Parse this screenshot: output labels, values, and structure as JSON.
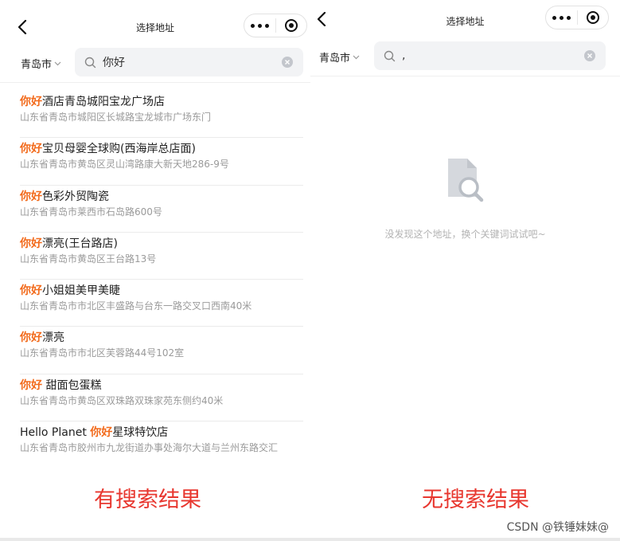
{
  "left": {
    "nav_title": "选择地址",
    "city": "青岛市",
    "search_value": "你好",
    "results": [
      {
        "highlight": "你好",
        "prefix": "",
        "name": "酒店青岛城阳宝龙广场店",
        "address": "山东省青岛市城阳区长城路宝龙城市广场东门"
      },
      {
        "highlight": "你好",
        "prefix": "",
        "name": "宝贝母婴全球购(西海岸总店面)",
        "address": "山东省青岛市黄岛区灵山湾路康大新天地286-9号"
      },
      {
        "highlight": "你好",
        "prefix": "",
        "name": "色彩外贸陶瓷",
        "address": "山东省青岛市莱西市石岛路600号"
      },
      {
        "highlight": "你好",
        "prefix": "",
        "name": "漂亮(王台路店)",
        "address": "山东省青岛市黄岛区王台路13号"
      },
      {
        "highlight": "你好",
        "prefix": "",
        "name": "小姐姐美甲美睫",
        "address": "山东省青岛市市北区丰盛路与台东一路交叉口西南40米"
      },
      {
        "highlight": "你好",
        "prefix": "",
        "name": "漂亮",
        "address": "山东省青岛市市北区芙蓉路44号102室"
      },
      {
        "highlight": "你好",
        "prefix": "",
        "name": " 甜面包蛋糕",
        "address": "山东省青岛市黄岛区双珠路双珠家苑东侧约40米"
      },
      {
        "highlight": "你好",
        "prefix": "Hello Planet ",
        "name": "星球特饮店",
        "address": "山东省青岛市胶州市九龙街道办事处海尔大道与兰州东路交汇"
      }
    ],
    "caption": "有搜索结果"
  },
  "right": {
    "nav_title": "选择地址",
    "city": "青岛市",
    "search_value": ",",
    "empty_message": "没发现这个地址，换个关键词试试吧~",
    "caption": "无搜索结果"
  },
  "watermark": "CSDN @铁锤妹妹@",
  "colors": {
    "highlight": "#f26a1b",
    "caption": "#e8372f",
    "search_bg": "#f2f3f5"
  },
  "icons": [
    "back-icon",
    "more-icon",
    "target-icon",
    "search-icon",
    "chevron-down-icon",
    "clear-icon",
    "document-search-icon"
  ]
}
